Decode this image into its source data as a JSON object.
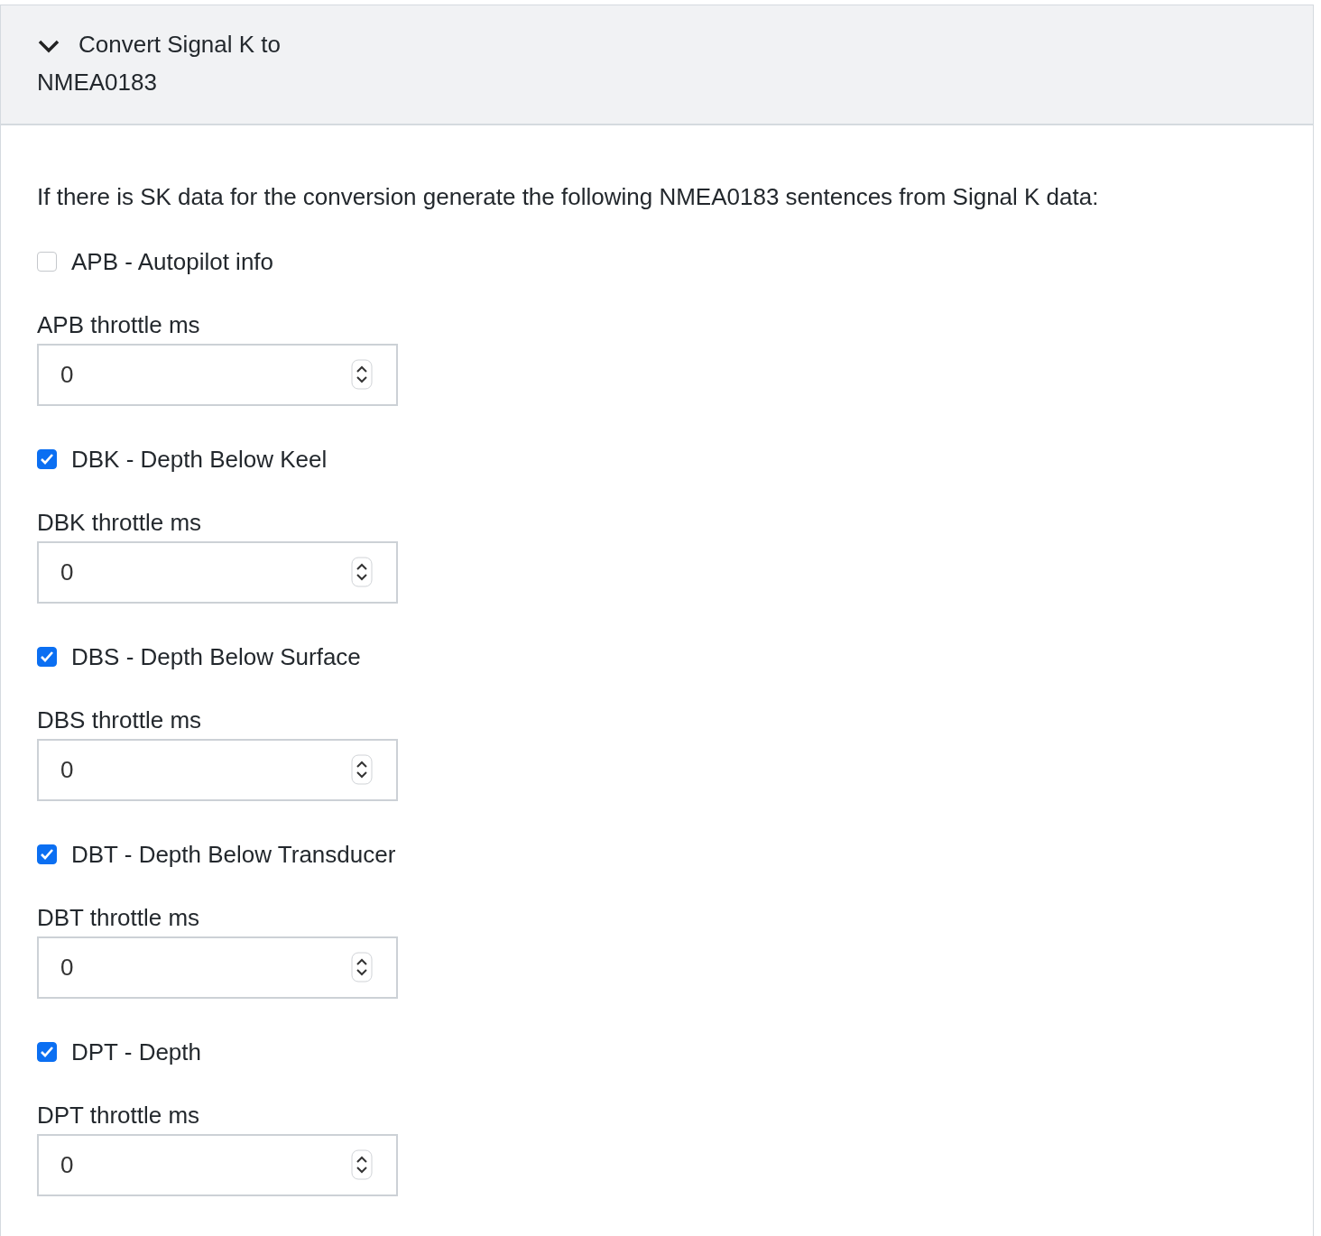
{
  "panel": {
    "title": "Convert Signal K to NMEA0183",
    "expanded": true
  },
  "description": "If there is SK data for the conversion generate the following NMEA0183 sentences from Signal K data:",
  "sentences": [
    {
      "label": "APB - Autopilot info",
      "checked": false,
      "throttle_label": "APB throttle ms",
      "throttle_value": "0"
    },
    {
      "label": "DBK - Depth Below Keel",
      "checked": true,
      "throttle_label": "DBK throttle ms",
      "throttle_value": "0"
    },
    {
      "label": "DBS - Depth Below Surface",
      "checked": true,
      "throttle_label": "DBS throttle ms",
      "throttle_value": "0"
    },
    {
      "label": "DBT - Depth Below Transducer",
      "checked": true,
      "throttle_label": "DBT throttle ms",
      "throttle_value": "0"
    },
    {
      "label": "DPT - Depth",
      "checked": true,
      "throttle_label": "DPT throttle ms",
      "throttle_value": "0"
    }
  ]
}
